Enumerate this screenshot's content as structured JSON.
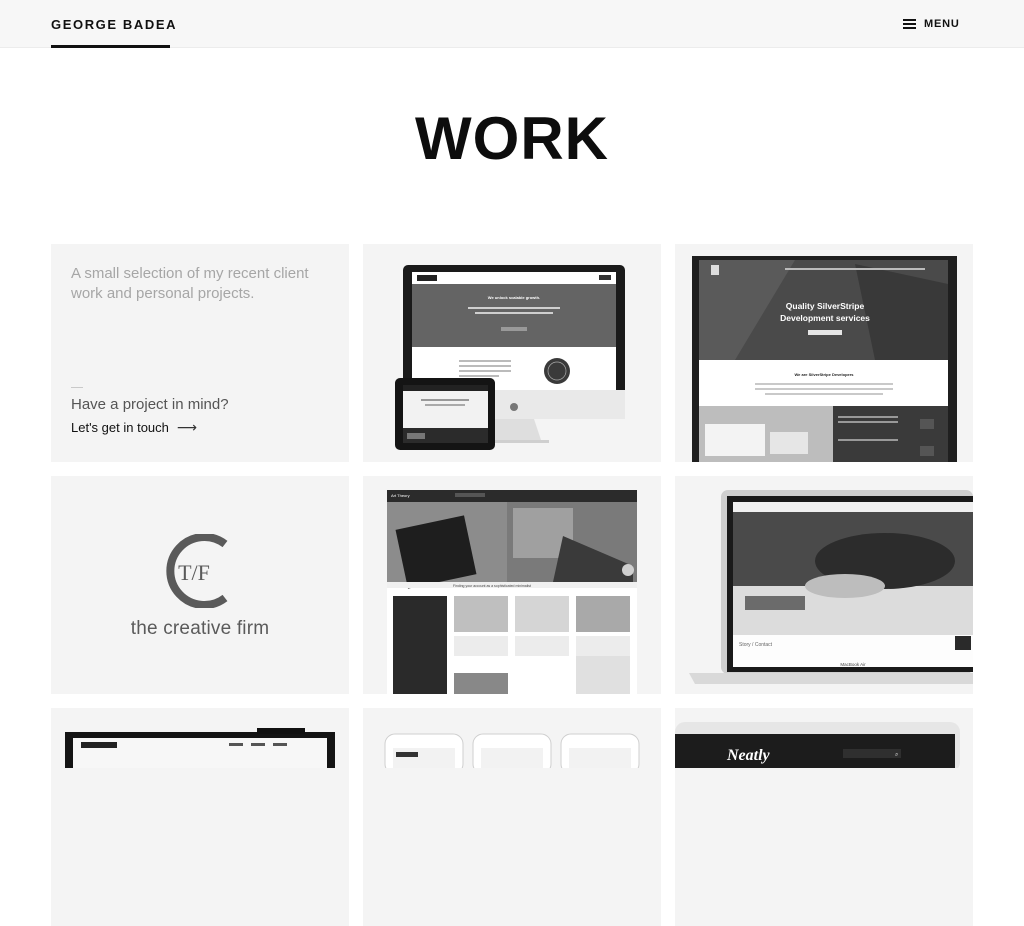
{
  "header": {
    "brand": "GEORGE BADEA",
    "menu_label": "MENU",
    "menu_icon": "hamburger-icon"
  },
  "page": {
    "title": "WORK"
  },
  "intro": {
    "text": "A small selection of my recent client work and personal projects.",
    "cta_question": "Have a project in mind?",
    "cta_link": "Let's get in touch",
    "cta_icon": "arrow-right-icon"
  },
  "projects": [
    {
      "caption": "We unlock scalable growth."
    },
    {
      "caption": "Quality SilverStripe Development services",
      "subcaption": "We are SilverStripe Developers"
    },
    {
      "logo_letters": "T/F",
      "name": "the creative firm"
    },
    {
      "header": "Art Theory",
      "banner": "Finding your account as a sophisticated minimalist"
    },
    {
      "nav": "Story / Contact",
      "brand": "MacBook Air"
    },
    {
      "logo": "Neatly"
    }
  ]
}
